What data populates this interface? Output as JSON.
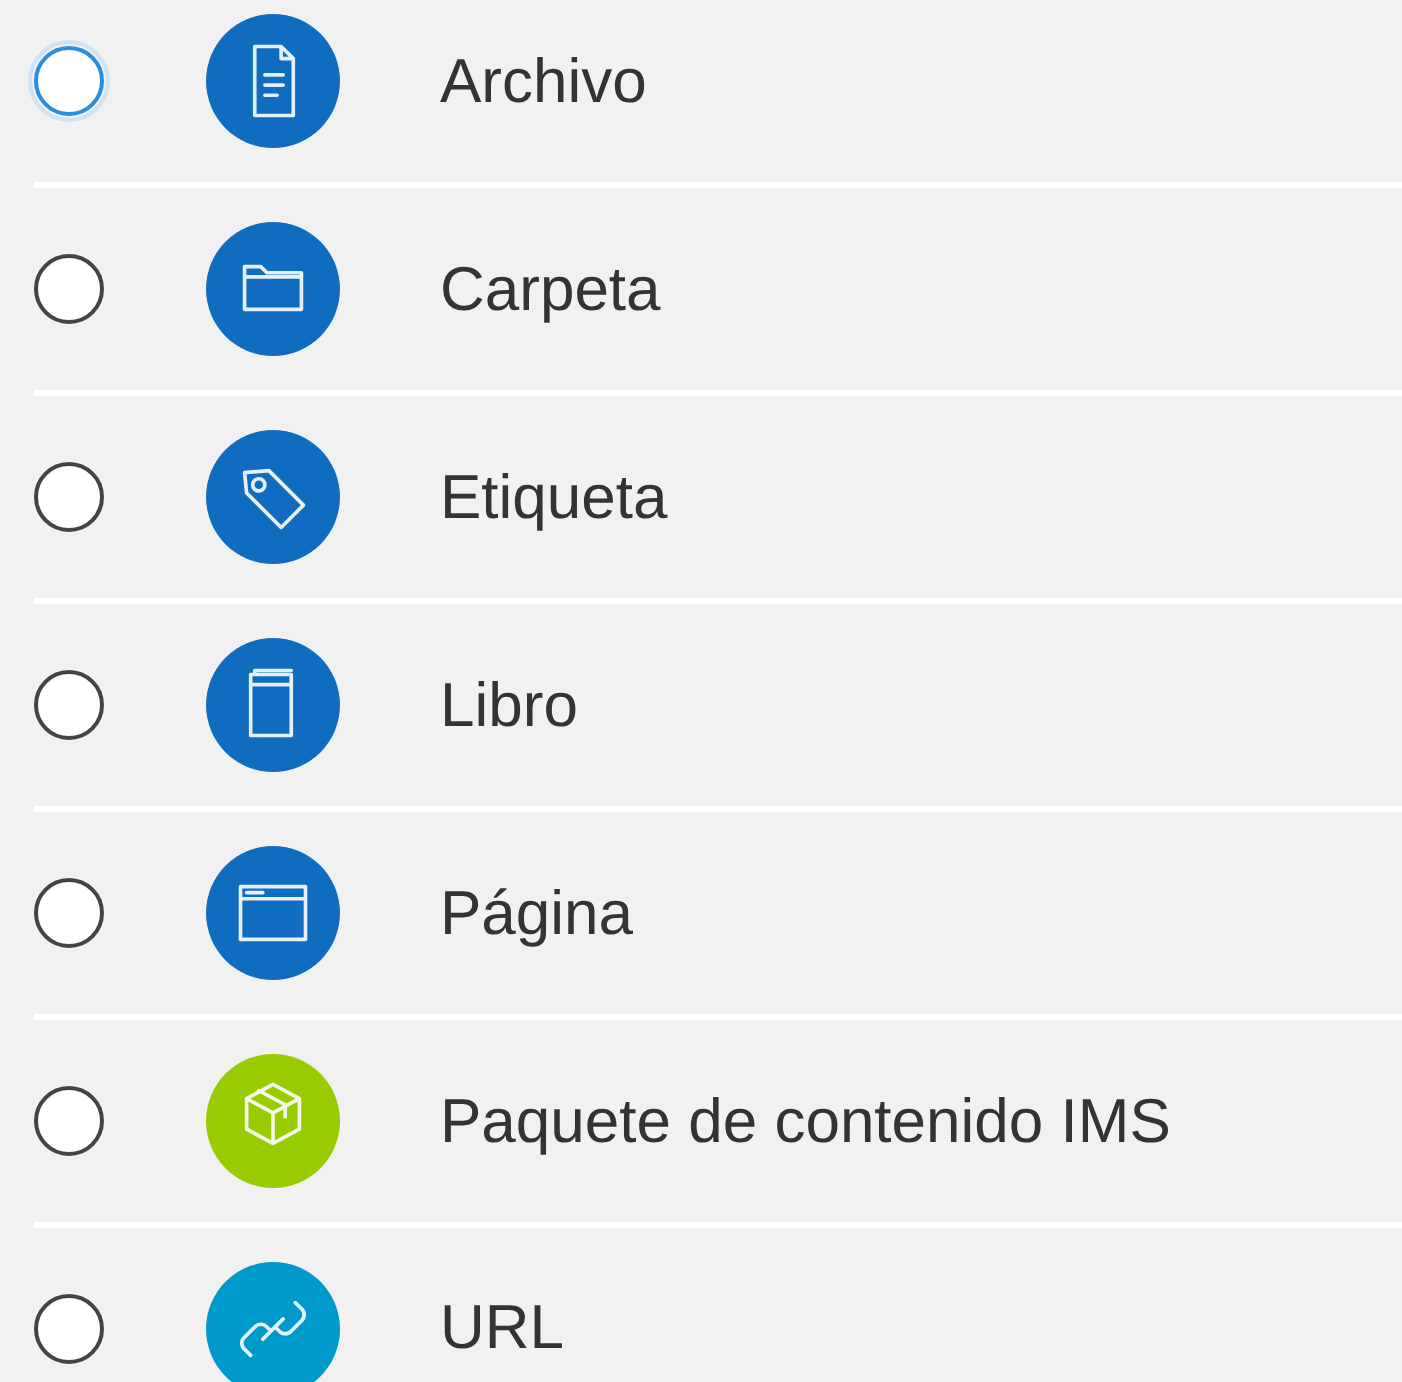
{
  "options": [
    {
      "label": "Archivo",
      "kind": "file",
      "color": "#0f6cbf",
      "selected": false,
      "focused": true
    },
    {
      "label": "Carpeta",
      "kind": "folder",
      "color": "#0f6cbf",
      "selected": false,
      "focused": false
    },
    {
      "label": "Etiqueta",
      "kind": "tag",
      "color": "#0f6cbf",
      "selected": false,
      "focused": false
    },
    {
      "label": "Libro",
      "kind": "book",
      "color": "#0f6cbf",
      "selected": false,
      "focused": false
    },
    {
      "label": "Página",
      "kind": "page",
      "color": "#0f6cbf",
      "selected": false,
      "focused": false
    },
    {
      "label": "Paquete de contenido IMS",
      "kind": "package",
      "color": "#99cc00",
      "selected": false,
      "focused": false
    },
    {
      "label": "URL",
      "kind": "link",
      "color": "#0099cc",
      "selected": false,
      "focused": false
    }
  ]
}
